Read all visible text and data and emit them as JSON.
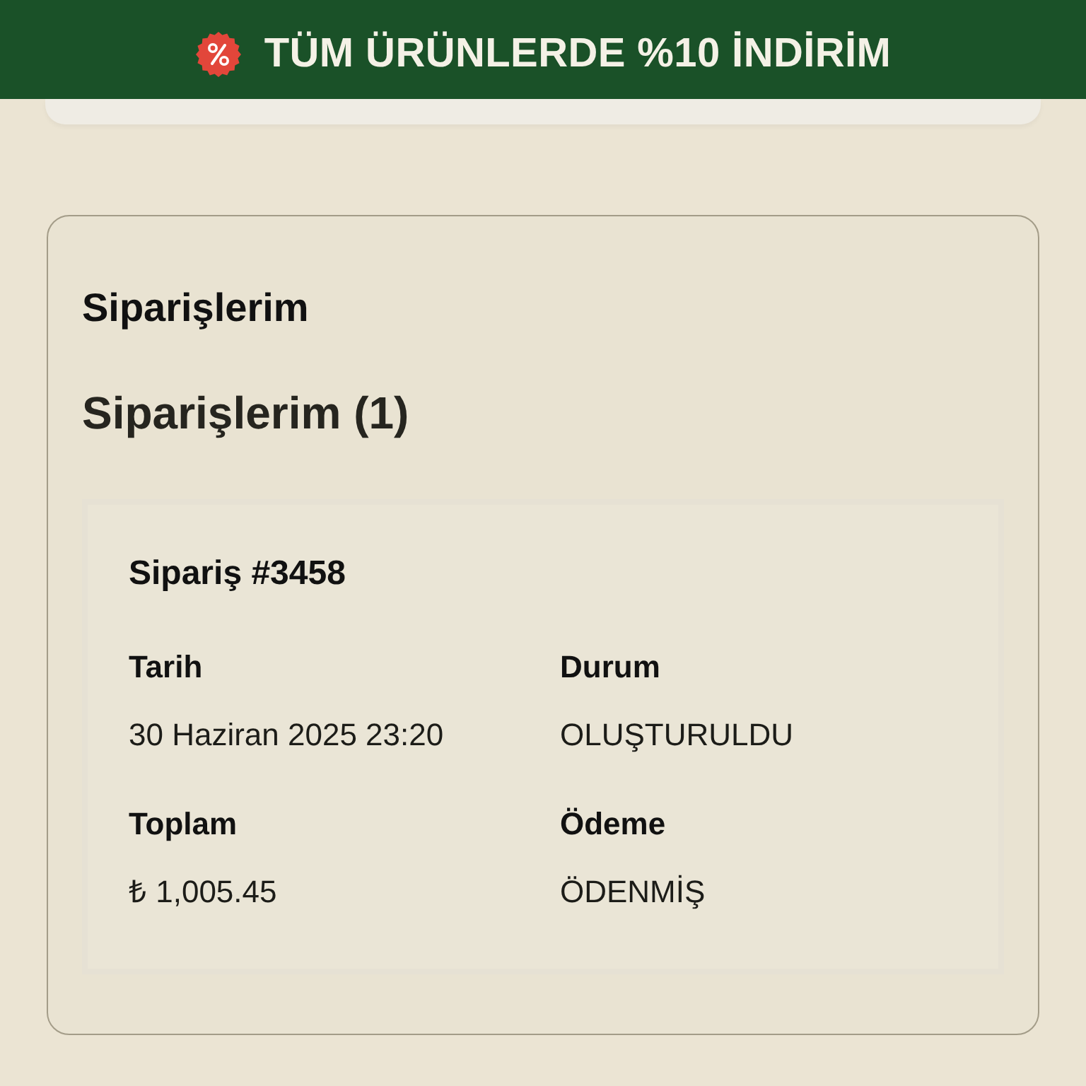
{
  "banner": {
    "text": "TÜM ÜRÜNLERDE %10 İNDİRİM"
  },
  "orders_section": {
    "title": "Siparişlerim",
    "heading": "Siparişlerim (1)",
    "orders": [
      {
        "title": "Sipariş #3458",
        "fields": [
          {
            "label": "Tarih",
            "value": "30 Haziran 2025 23:20"
          },
          {
            "label": "Durum",
            "value": "OLUŞTURULDU"
          },
          {
            "label": "Toplam",
            "value": "₺ 1,005.45"
          },
          {
            "label": "Ödeme",
            "value": "ÖDENMİŞ"
          }
        ]
      }
    ]
  }
}
